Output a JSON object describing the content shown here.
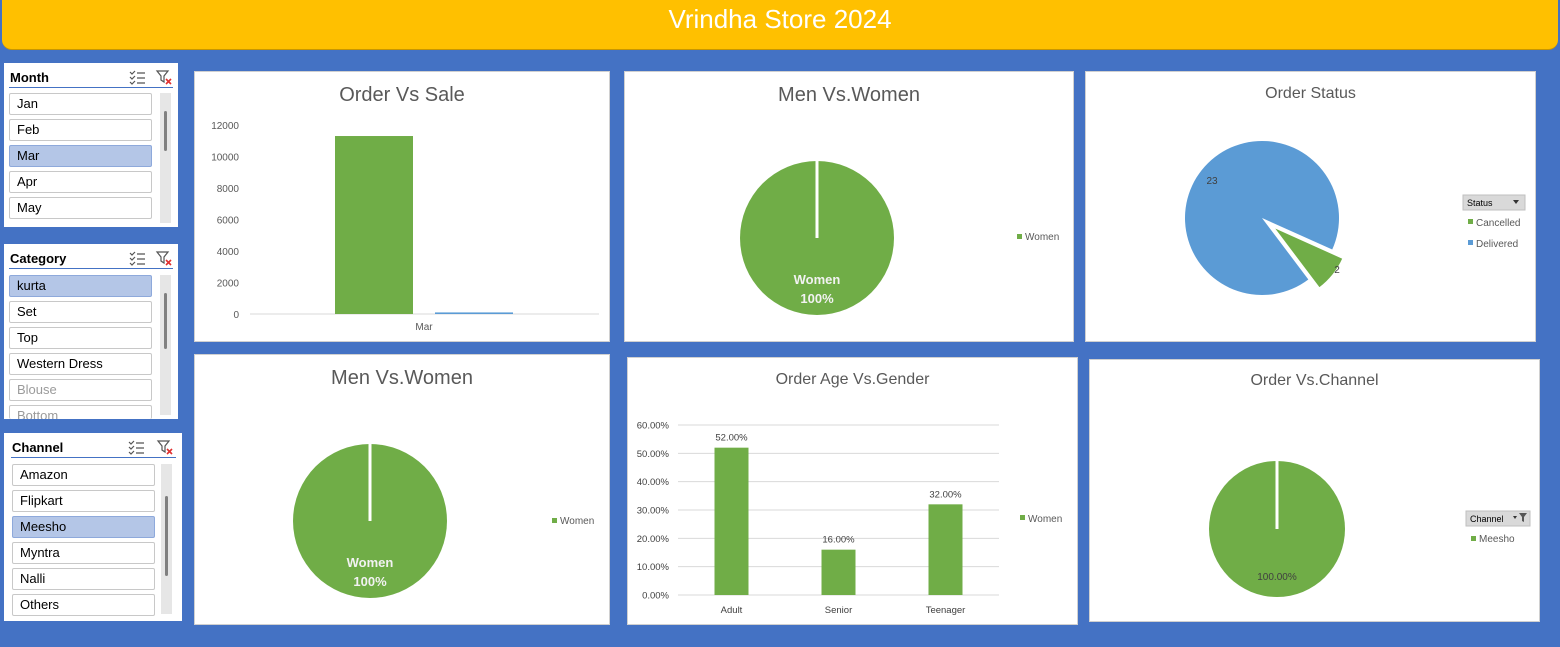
{
  "title": "Vrindha Store 2024",
  "slicers": {
    "month": {
      "title": "Month",
      "items": [
        "Jan",
        "Feb",
        "Mar",
        "Apr",
        "May"
      ],
      "selected": "Mar"
    },
    "category": {
      "title": "Category",
      "items": [
        "kurta",
        "Set",
        "Top",
        "Western Dress",
        "Blouse",
        "Bottom"
      ],
      "selected": "kurta"
    },
    "channel": {
      "title": "Channel",
      "items": [
        "Amazon",
        "Flipkart",
        "Meesho",
        "Myntra",
        "Nalli",
        "Others"
      ],
      "selected": "Meesho"
    }
  },
  "charts": {
    "order_vs_sale": {
      "title": "Order Vs Sale",
      "chart_data": {
        "type": "bar",
        "categories": [
          "Mar"
        ],
        "series": [
          {
            "values": [
              11300
            ],
            "color": "#70ad47"
          },
          {
            "values": [
              100
            ],
            "color": "#5b9bd5"
          }
        ],
        "yticks": [
          "0",
          "2000",
          "4000",
          "6000",
          "8000",
          "10000",
          "12000"
        ],
        "ylim": [
          0,
          12000
        ]
      }
    },
    "men_vs_women_1": {
      "title": "Men Vs.Women",
      "chart_data": {
        "type": "pie",
        "slices": [
          {
            "label": "Women",
            "value": 100,
            "color": "#70ad47"
          }
        ],
        "data_label_name": "Women",
        "data_label_pct": "100%",
        "legend": [
          "Women"
        ],
        "legend_position": "right"
      }
    },
    "order_status": {
      "title": "Order Status",
      "chart_data": {
        "type": "pie",
        "slices": [
          {
            "label": "Delivered",
            "value": 23,
            "color": "#5b9bd5"
          },
          {
            "label": "Cancelled",
            "value": 2,
            "color": "#70ad47"
          }
        ],
        "data_labels": [
          "23",
          "2"
        ],
        "legend_header": "Status",
        "legend": [
          "Cancelled",
          "Delivered"
        ],
        "legend_position": "right"
      }
    },
    "men_vs_women_2": {
      "title": "Men Vs.Women",
      "chart_data": {
        "type": "pie",
        "slices": [
          {
            "label": "Women",
            "value": 100,
            "color": "#70ad47"
          }
        ],
        "data_label_name": "Women",
        "data_label_pct": "100%",
        "legend": [
          "Women"
        ],
        "legend_position": "right"
      }
    },
    "order_age_vs_gender": {
      "title": "Order Age Vs.Gender",
      "chart_data": {
        "type": "bar",
        "categories": [
          "Adult",
          "Senior",
          "Teenager"
        ],
        "series": [
          {
            "name": "Women",
            "values": [
              52,
              16,
              32
            ],
            "color": "#70ad47"
          }
        ],
        "data_labels": [
          "52.00%",
          "16.00%",
          "32.00%"
        ],
        "yticks": [
          "0.00%",
          "10.00%",
          "20.00%",
          "30.00%",
          "40.00%",
          "50.00%",
          "60.00%"
        ],
        "ylim": [
          0,
          60
        ],
        "legend": [
          "Women"
        ],
        "legend_position": "right"
      }
    },
    "order_vs_channel": {
      "title": "Order Vs.Channel",
      "chart_data": {
        "type": "pie",
        "slices": [
          {
            "label": "Meesho",
            "value": 100,
            "color": "#70ad47"
          }
        ],
        "data_label_pct": "100.00%",
        "legend_header": "Channel",
        "legend": [
          "Meesho"
        ],
        "legend_position": "right"
      }
    }
  }
}
